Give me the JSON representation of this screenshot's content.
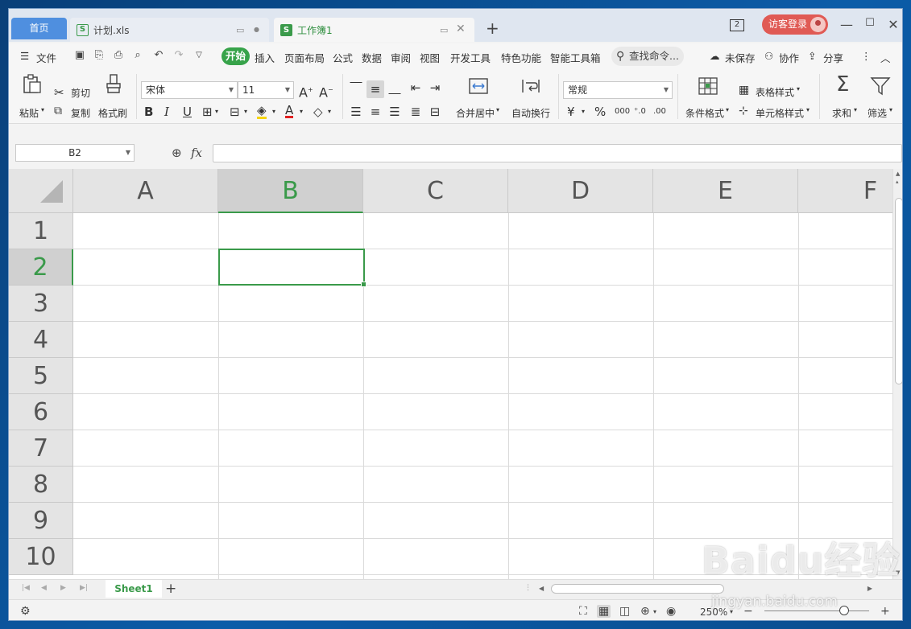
{
  "tabs": {
    "home": "首页",
    "doc1": "计划.xls",
    "doc2": "工作簿1",
    "doc_icon_letter": "S"
  },
  "titlebar": {
    "window_count": "2",
    "login": "访客登录"
  },
  "menu": {
    "file": "文件",
    "start": "开始",
    "items": [
      "插入",
      "页面布局",
      "公式",
      "数据",
      "审阅",
      "视图",
      "开发工具",
      "特色功能",
      "智能工具箱"
    ],
    "search": "查找命令...",
    "unsaved": "未保存",
    "collab": "协作",
    "share": "分享"
  },
  "ribbon": {
    "paste": "粘贴",
    "cut": "剪切",
    "copy": "复制",
    "format_painter": "格式刷",
    "font_name": "宋体",
    "font_size": "11",
    "merge_center": "合并居中",
    "wrap_text": "自动换行",
    "number_format": "常规",
    "cond_format": "条件格式",
    "table_style": "表格样式",
    "cell_style": "单元格样式",
    "sum": "求和",
    "filter": "筛选",
    "currency": "¥",
    "percent": "%",
    "thousands": "000"
  },
  "formula": {
    "name_box": "B2",
    "fx": "fx",
    "value": ""
  },
  "grid": {
    "columns": [
      "A",
      "B",
      "C",
      "D",
      "E",
      "F"
    ],
    "rows": [
      "1",
      "2",
      "3",
      "4",
      "5",
      "6",
      "7",
      "8",
      "9",
      "10"
    ],
    "selected_col": "B",
    "selected_row": "2"
  },
  "sheets": {
    "active": "Sheet1",
    "add": "+"
  },
  "status": {
    "zoom": "250%"
  },
  "watermark": {
    "logo": "Baidu经验",
    "url": "jingyan.baidu.com"
  },
  "colors": {
    "accent": "#3a9a4a",
    "home_tab": "#4f8fdf",
    "login": "#e05a54"
  }
}
